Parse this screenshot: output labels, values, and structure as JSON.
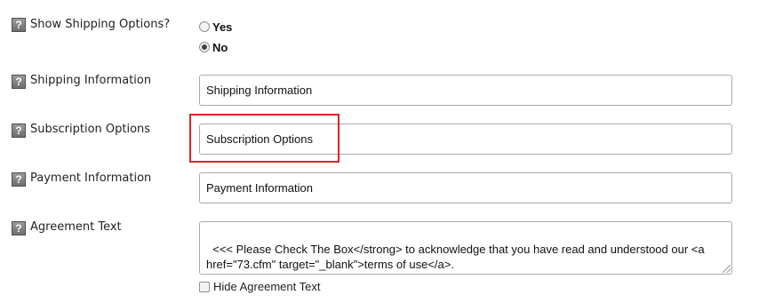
{
  "help_icon_glyph": "?",
  "shipping_options": {
    "label": "Show Shipping Options?",
    "options": [
      {
        "label": "Yes",
        "selected": false
      },
      {
        "label": "No",
        "selected": true
      }
    ]
  },
  "shipping_information": {
    "label": "Shipping Information",
    "value": "Shipping Information"
  },
  "subscription_options": {
    "label": "Subscription Options",
    "value": "Subscription Options"
  },
  "payment_information": {
    "label": "Payment Information",
    "value": "Payment Information"
  },
  "agreement_text": {
    "label": "Agreement Text",
    "value": "<<< Please Check The Box</strong> to acknowledge that you have read and understood our <a href=\"73.cfm\" target=\"_blank\">terms of use</a>.",
    "hide_label": "Hide Agreement Text",
    "hide_checked": false
  },
  "colors": {
    "highlight": "#e0222a",
    "help_icon": "#7a7a7a"
  }
}
